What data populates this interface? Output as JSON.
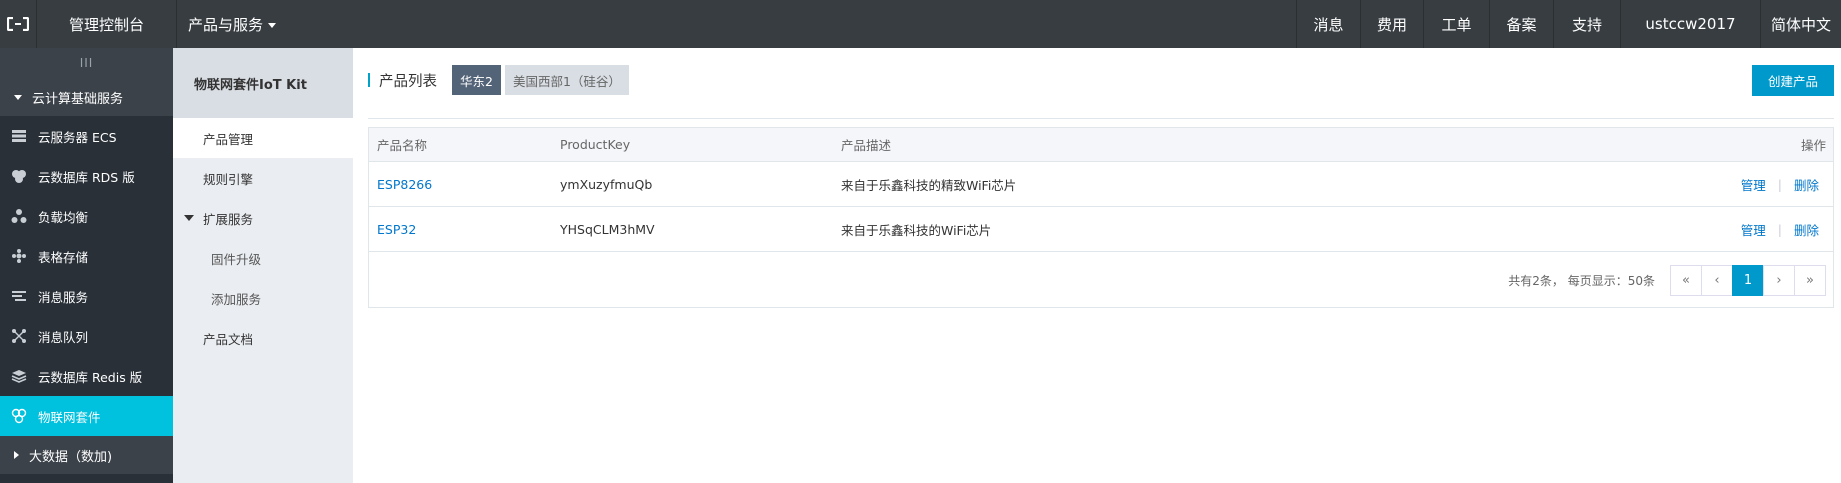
{
  "topbar": {
    "console": "管理控制台",
    "products": "产品与服务",
    "nav": [
      "消息",
      "费用",
      "工单",
      "备案",
      "支持",
      "ustccw2017",
      "简体中文"
    ]
  },
  "sidebar": {
    "collapse_glyph": "III",
    "group_expanded": "云计算基础服务",
    "items": [
      {
        "label": "云服务器 ECS",
        "icon": "server-icon"
      },
      {
        "label": "云数据库 RDS 版",
        "icon": "database-icon"
      },
      {
        "label": "负载均衡",
        "icon": "load-balancer-icon"
      },
      {
        "label": "表格存储",
        "icon": "table-storage-icon"
      },
      {
        "label": "消息服务",
        "icon": "message-service-icon"
      },
      {
        "label": "消息队列",
        "icon": "message-queue-icon"
      },
      {
        "label": "云数据库 Redis 版",
        "icon": "redis-icon"
      },
      {
        "label": "物联网套件",
        "icon": "iot-icon",
        "active": true
      }
    ],
    "group_collapsed": "大数据（数加)"
  },
  "subnav": {
    "title": "物联网套件IoT Kit",
    "items": [
      "产品管理",
      "规则引擎"
    ],
    "group": "扩展服务",
    "sub_items": [
      "固件升级",
      "添加服务"
    ],
    "last": "产品文档"
  },
  "main": {
    "title": "产品列表",
    "regions": [
      "华东2",
      "美国西部1（硅谷）"
    ],
    "create_button": "创建产品",
    "columns": [
      "产品名称",
      "ProductKey",
      "产品描述",
      "操作"
    ],
    "rows": [
      {
        "name": "ESP8266",
        "key": "ymXuzyfmuQb",
        "desc": "来自于乐鑫科技的精致WiFi芯片",
        "manage": "管理",
        "delete": "删除"
      },
      {
        "name": "ESP32",
        "key": "YHSqCLM3hMV",
        "desc": "来自于乐鑫科技的WiFi芯片",
        "manage": "管理",
        "delete": "删除"
      }
    ],
    "pager": {
      "info": "共有2条， 每页显示：50条",
      "first": "«",
      "prev": "‹",
      "current": "1",
      "next": "›",
      "last": "»"
    },
    "separator": "|"
  },
  "colors": {
    "topbar": "#373d41",
    "sidebar": "#293038",
    "accent": "#00c1de",
    "primary": "#0099cc",
    "link": "#0077cc"
  }
}
